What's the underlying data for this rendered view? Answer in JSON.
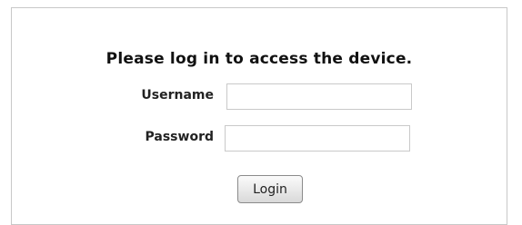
{
  "login": {
    "heading": "Please log in to access the device.",
    "username_label": "Username",
    "username_value": "",
    "password_label": "Password",
    "password_value": "",
    "login_button": "Login"
  }
}
